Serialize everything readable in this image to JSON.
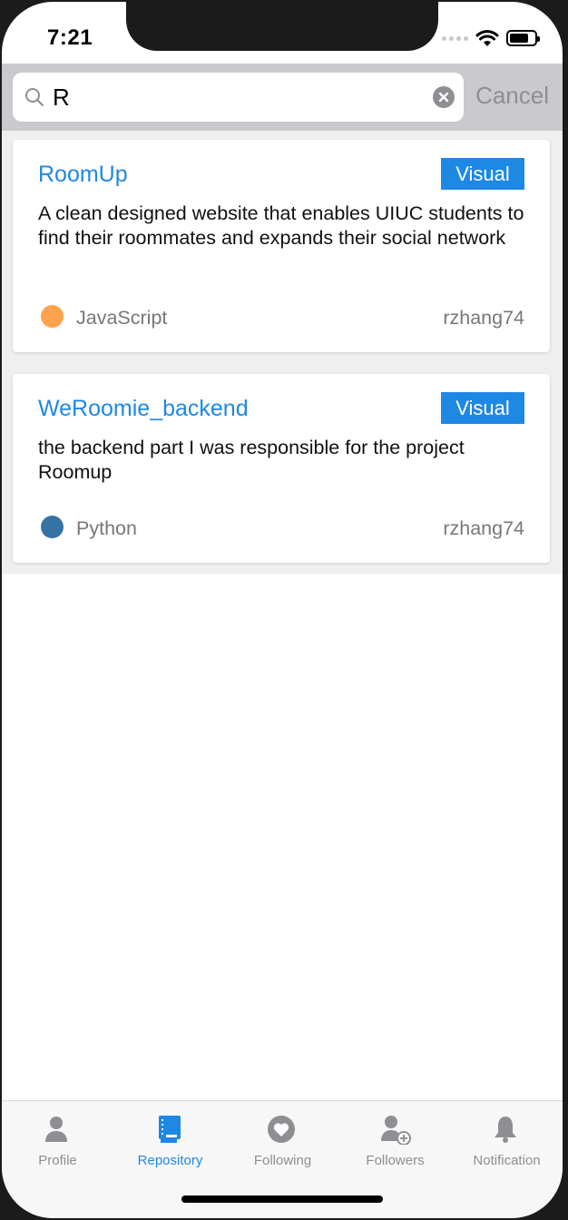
{
  "status": {
    "time": "7:21"
  },
  "search": {
    "query": "R",
    "cancel_label": "Cancel"
  },
  "repos": [
    {
      "name": "RoomUp",
      "badge": "Visual",
      "description": "A clean designed website that enables UIUC students to find their roommates and expands their social network",
      "language": "JavaScript",
      "language_color": "#ffa34d",
      "owner": "rzhang74"
    },
    {
      "name": "WeRoomie_backend",
      "badge": "Visual",
      "description": "the backend part I was responsible for the project Roomup",
      "language": "Python",
      "language_color": "#3572a5",
      "owner": "rzhang74"
    }
  ],
  "tabs": [
    {
      "label": "Profile",
      "icon": "person-icon",
      "active": false
    },
    {
      "label": "Repository",
      "icon": "book-icon",
      "active": true
    },
    {
      "label": "Following",
      "icon": "heart-icon",
      "active": false
    },
    {
      "label": "Followers",
      "icon": "person-add-icon",
      "active": false
    },
    {
      "label": "Notification",
      "icon": "bell-icon",
      "active": false
    }
  ],
  "colors": {
    "accent": "#1e88e5",
    "tab_inactive": "#8e8e93"
  }
}
